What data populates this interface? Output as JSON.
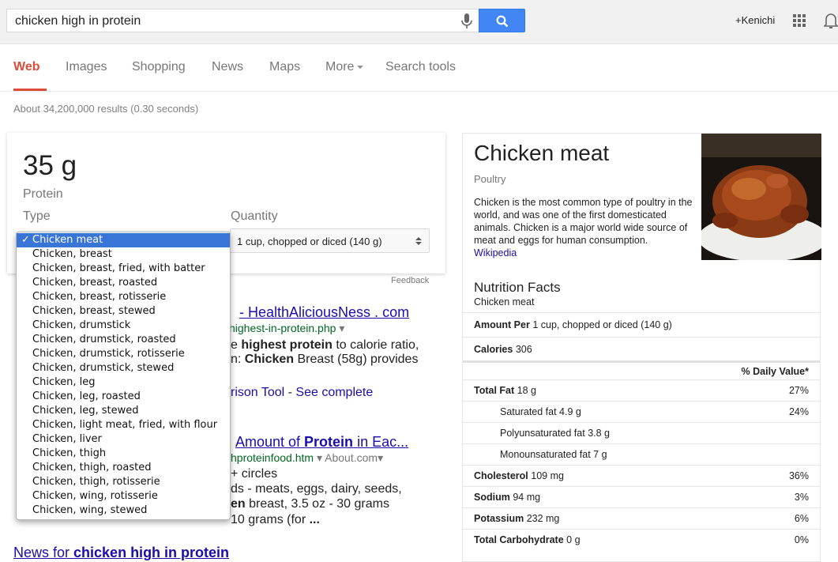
{
  "search": {
    "query": "chicken high in protein"
  },
  "account": {
    "user": "+Kenichi"
  },
  "tabs": [
    "Web",
    "Images",
    "Shopping",
    "News",
    "Maps",
    "More",
    "Search tools"
  ],
  "result_stats": "About 34,200,000 results (0.30 seconds)",
  "answer": {
    "value": "35 g",
    "label": "Protein",
    "type_label": "Type",
    "quantity_label": "Quantity",
    "quantity_value": "1 cup, chopped or diced (140 g)",
    "feedback": "Feedback"
  },
  "type_options": [
    "Chicken meat",
    "Chicken, breast",
    "Chicken, breast, fried, with batter",
    "Chicken, breast, roasted",
    "Chicken, breast, rotisserie",
    "Chicken, breast, stewed",
    "Chicken, drumstick",
    "Chicken, drumstick, roasted",
    "Chicken, drumstick, rotisserie",
    "Chicken, drumstick, stewed",
    "Chicken, leg",
    "Chicken, leg, roasted",
    "Chicken, leg, stewed",
    "Chicken, light meat, fried, with flour",
    "Chicken, liver",
    "Chicken, thigh",
    "Chicken, thigh, roasted",
    "Chicken, thigh, rotisserie",
    "Chicken, wing, rotisserie",
    "Chicken, wing, stewed"
  ],
  "selected_type_index": 0,
  "results": {
    "r1_title_tail": "- HealthAliciousNess . com",
    "r1_url_tail": "highest-in-protein.php",
    "r1_snip1_a": "e ",
    "r1_snip1_b": "highest protein",
    "r1_snip1_c": " to calorie ratio,",
    "r1_snip2_a": "n: ",
    "r1_snip2_b": "Chicken",
    "r1_snip2_c": " Breast (58g) provides",
    "r1_links_a": "rison Tool",
    "r1_links_sep": " - ",
    "r1_links_b": "See complete",
    "r2_title_a": "Amount of ",
    "r2_title_b": "Protein",
    "r2_title_c": " in Eac...",
    "r2_url_a": "hprotein",
    "r2_url_b": "food.htm",
    "r2_url_c": "About.com",
    "r2_snip1": "+ circles",
    "r2_snip2_a": "ds - meats, eggs, dairy, seeds,",
    "r2_snip3_a": "en",
    "r2_snip3_b": " breast, 3.5 oz - 30 grams",
    "r2_snip4_a": "10 grams (for ",
    "r2_snip4_b": "...",
    "news_a": "News for ",
    "news_b": "chicken high in protein"
  },
  "knowledge_panel": {
    "title": "Chicken meat",
    "subtitle": "Poultry",
    "description": "Chicken is the most common type of poultry in the world, and was one of the first domesticated animals. Chicken is a major world wide source of meat and eggs for human consumption.",
    "source": "Wikipedia",
    "nutrition_title": "Nutrition Facts",
    "nutrition_sub": "Chicken meat",
    "amount_per_label": "Amount Per",
    "amount_per_value": "1 cup, chopped or diced (140 g)",
    "calories_label": "Calories",
    "calories_value": "306",
    "daily_value_header": "% Daily Value*",
    "rows": [
      {
        "name": "Total Fat",
        "value": "18 g",
        "pct": "27%",
        "bold": true,
        "indent": false
      },
      {
        "name": "Saturated fat",
        "value": "4.9 g",
        "pct": "24%",
        "bold": false,
        "indent": true
      },
      {
        "name": "Polyunsaturated fat",
        "value": "3.8 g",
        "pct": "",
        "bold": false,
        "indent": true
      },
      {
        "name": "Monounsaturated fat",
        "value": "7 g",
        "pct": "",
        "bold": false,
        "indent": true
      },
      {
        "name": "Cholesterol",
        "value": "109 mg",
        "pct": "36%",
        "bold": true,
        "indent": false
      },
      {
        "name": "Sodium",
        "value": "94 mg",
        "pct": "3%",
        "bold": true,
        "indent": false
      },
      {
        "name": "Potassium",
        "value": "232 mg",
        "pct": "6%",
        "bold": true,
        "indent": false
      },
      {
        "name": "Total Carbohydrate",
        "value": "0 g",
        "pct": "0%",
        "bold": true,
        "indent": false
      }
    ]
  },
  "colors": {
    "accent": "#dd4b39",
    "link": "#1a0dab",
    "url": "#006621",
    "search_button": "#4285f4",
    "dropdown_selected": "#3875d7"
  }
}
